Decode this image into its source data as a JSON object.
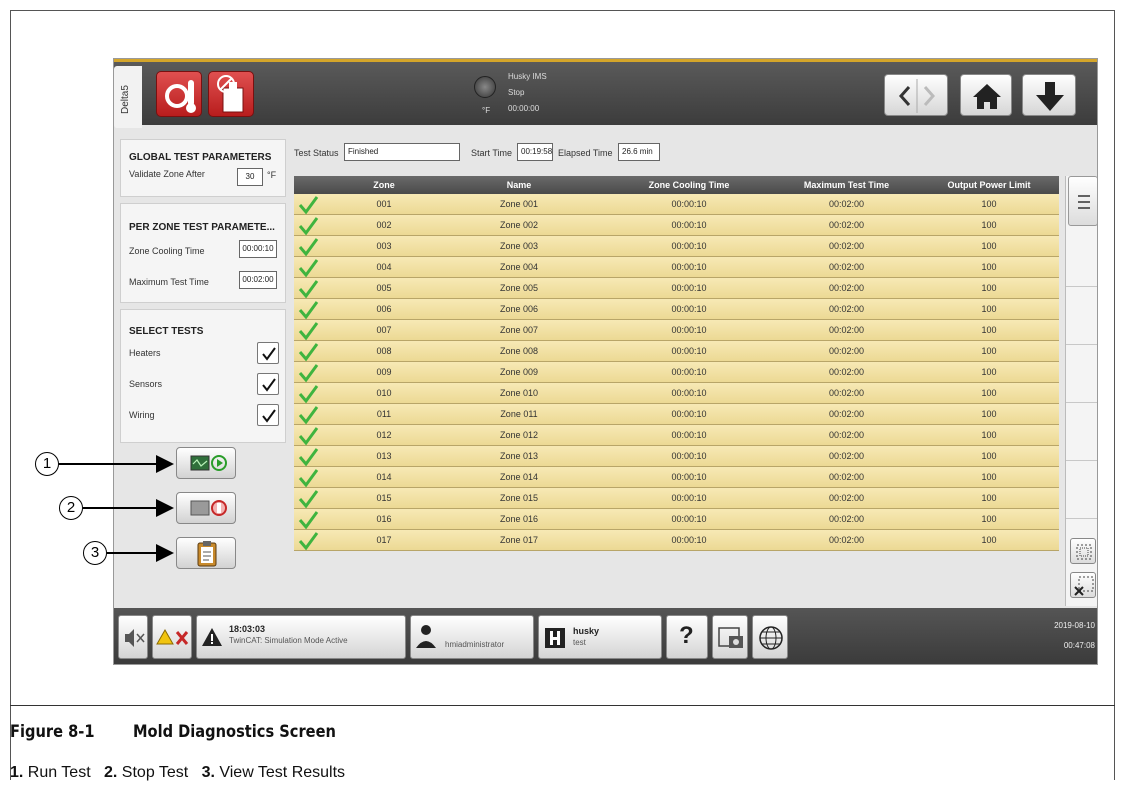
{
  "app": {
    "side_tab": "Delta5",
    "status_lines": [
      "Husky IMS",
      "Stop",
      "00:00:00"
    ],
    "temp_unit": "°F"
  },
  "global_params": {
    "title": "GLOBAL TEST PARAMETERS",
    "validate_label": "Validate Zone After",
    "validate_value": "30",
    "validate_unit": "°F"
  },
  "per_zone_params": {
    "title": "PER ZONE TEST PARAMETE...",
    "cooling_label": "Zone Cooling Time",
    "cooling_value": "00:00:10",
    "max_label": "Maximum Test Time",
    "max_value": "00:02:00"
  },
  "select_tests": {
    "title": "SELECT TESTS",
    "items": [
      {
        "label": "Heaters",
        "checked": true
      },
      {
        "label": "Sensors",
        "checked": true
      },
      {
        "label": "Wiring",
        "checked": true
      }
    ]
  },
  "test_header": {
    "status_label": "Test Status",
    "status_value": "Finished",
    "start_label": "Start Time",
    "start_value": "00:19:58",
    "elapsed_label": "Elapsed Time",
    "elapsed_value": "26.6 min"
  },
  "table": {
    "columns": [
      "Zone",
      "Name",
      "Zone Cooling Time",
      "Maximum Test Time",
      "Output Power Limit"
    ],
    "rows": [
      [
        "001",
        "Zone 001",
        "00:00:10",
        "00:02:00",
        "100"
      ],
      [
        "002",
        "Zone 002",
        "00:00:10",
        "00:02:00",
        "100"
      ],
      [
        "003",
        "Zone 003",
        "00:00:10",
        "00:02:00",
        "100"
      ],
      [
        "004",
        "Zone 004",
        "00:00:10",
        "00:02:00",
        "100"
      ],
      [
        "005",
        "Zone 005",
        "00:00:10",
        "00:02:00",
        "100"
      ],
      [
        "006",
        "Zone 006",
        "00:00:10",
        "00:02:00",
        "100"
      ],
      [
        "007",
        "Zone 007",
        "00:00:10",
        "00:02:00",
        "100"
      ],
      [
        "008",
        "Zone 008",
        "00:00:10",
        "00:02:00",
        "100"
      ],
      [
        "009",
        "Zone 009",
        "00:00:10",
        "00:02:00",
        "100"
      ],
      [
        "010",
        "Zone 010",
        "00:00:10",
        "00:02:00",
        "100"
      ],
      [
        "011",
        "Zone 011",
        "00:00:10",
        "00:02:00",
        "100"
      ],
      [
        "012",
        "Zone 012",
        "00:00:10",
        "00:02:00",
        "100"
      ],
      [
        "013",
        "Zone 013",
        "00:00:10",
        "00:02:00",
        "100"
      ],
      [
        "014",
        "Zone 014",
        "00:00:10",
        "00:02:00",
        "100"
      ],
      [
        "015",
        "Zone 015",
        "00:00:10",
        "00:02:00",
        "100"
      ],
      [
        "016",
        "Zone 016",
        "00:00:10",
        "00:02:00",
        "100"
      ],
      [
        "017",
        "Zone 017",
        "00:00:10",
        "00:02:00",
        "100"
      ]
    ]
  },
  "bottom": {
    "alarm_time": "18:03:03",
    "alarm_text": "TwinCAT: Simulation Mode Active",
    "user": "hmiadministrator",
    "brand": "husky",
    "brand_sub": "test",
    "help": "?",
    "date": "2019-08-10",
    "time": "00:47:08"
  },
  "callouts": [
    "1",
    "2",
    "3"
  ],
  "caption": {
    "figure_number": "Figure 8-1",
    "figure_title": "Mold Diagnostics Screen",
    "legend": [
      {
        "num": "1.",
        "text": "Run Test"
      },
      {
        "num": "2.",
        "text": "Stop Test"
      },
      {
        "num": "3.",
        "text": "View Test Results"
      }
    ]
  },
  "colors": {
    "row_fill": "#f2e2a6",
    "accent_gold": "#d4a52a",
    "check_green": "#3fb43f",
    "danger_red": "#c62828"
  }
}
